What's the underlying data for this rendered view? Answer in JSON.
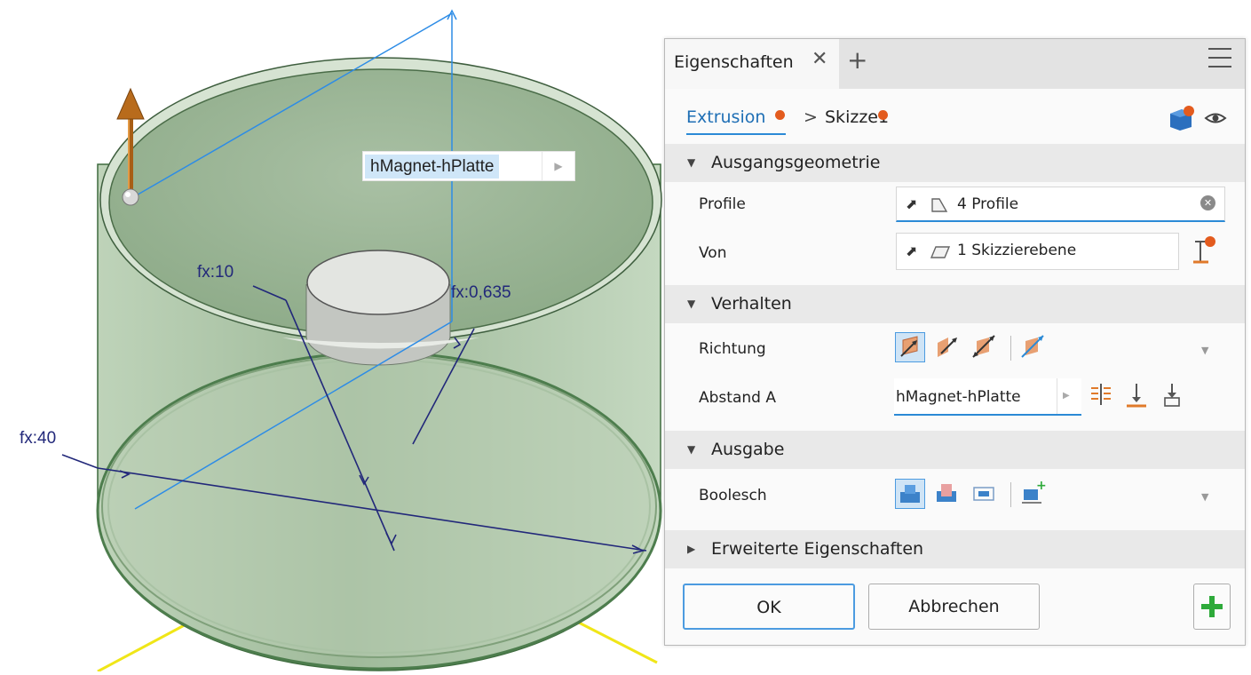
{
  "viewport": {
    "dim_labels": {
      "fx10": "fx:10",
      "fx0635": "fx:0,635",
      "fx40": "fx:40"
    },
    "dimension_input_value": "hMagnet-hPlatte"
  },
  "panel": {
    "tab_label": "Eigenschaften",
    "breadcrumb": {
      "extrusion": "Extrusion",
      "separator": ">",
      "sketch": "Skizze1"
    },
    "sections": {
      "ausgangsgeometrie": {
        "title": "Ausgangsgeometrie",
        "profile_label": "Profile",
        "profile_value": "4 Profile",
        "von_label": "Von",
        "von_value": "1 Skizzierebene"
      },
      "verhalten": {
        "title": "Verhalten",
        "richtung_label": "Richtung",
        "abstand_label": "Abstand A",
        "abstand_value": "hMagnet-hPlatte"
      },
      "ausgabe": {
        "title": "Ausgabe",
        "boolesch_label": "Boolesch"
      },
      "erweitert": {
        "title": "Erweiterte Eigenschaften"
      }
    },
    "buttons": {
      "ok": "OK",
      "cancel": "Abbrechen"
    }
  },
  "colors": {
    "accent": "#2b8ad6",
    "dimension": "#22287a",
    "sketch": "#2d8ce6",
    "body_fill": "#b7cfb2",
    "add_green": "#2eaa3a",
    "badge": "#e35b1e"
  }
}
